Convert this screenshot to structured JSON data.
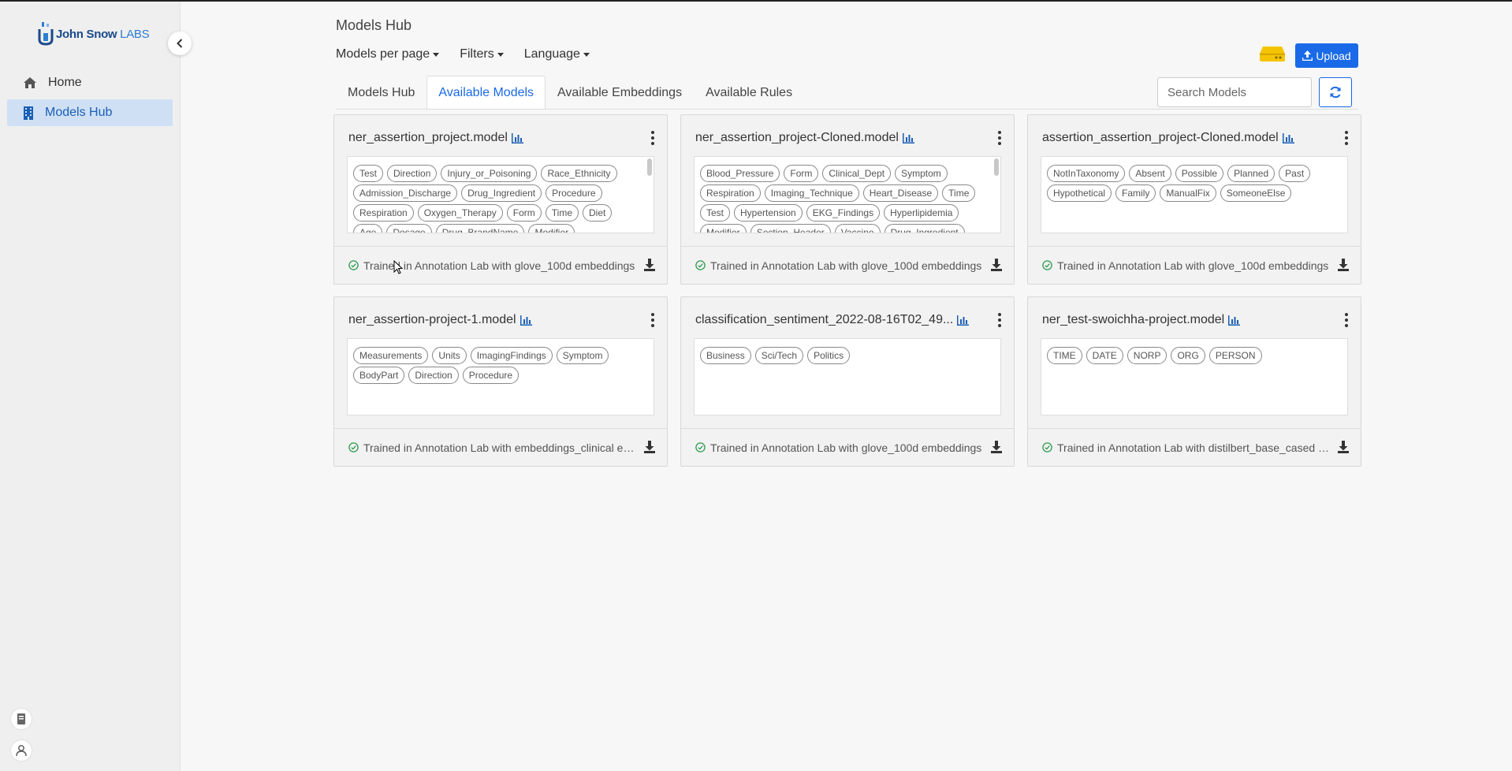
{
  "sidebar": {
    "logo": {
      "brand": "John Snow",
      "labs": "LABS"
    },
    "items": [
      {
        "label": "Home",
        "icon": "home-icon",
        "active": false
      },
      {
        "label": "Models Hub",
        "icon": "building-icon",
        "active": true
      }
    ]
  },
  "header": {
    "title": "Models Hub",
    "menus": [
      "Models per page",
      "Filters",
      "Language"
    ],
    "upload_label": "Upload"
  },
  "tabs": [
    {
      "label": "Models Hub",
      "active": false
    },
    {
      "label": "Available Models",
      "active": true
    },
    {
      "label": "Available Embeddings",
      "active": false
    },
    {
      "label": "Available Rules",
      "active": false
    }
  ],
  "search": {
    "placeholder": "Search Models",
    "value": ""
  },
  "colors": {
    "accent": "#1a6ae8",
    "success": "#2e9b50",
    "storage": "#f5c400"
  },
  "cards": [
    {
      "name": "ner_assertion_project.model",
      "labels": [
        "Test",
        "Direction",
        "Injury_or_Poisoning",
        "Race_Ethnicity",
        "Admission_Discharge",
        "Drug_Ingredient",
        "Procedure",
        "Respiration",
        "Oxygen_Therapy",
        "Form",
        "Time",
        "Diet",
        "Age",
        "Dosage",
        "Drug_BrandName",
        "Modifier"
      ],
      "footer": "Trained in Annotation Lab with glove_100d embeddings",
      "scroll": true
    },
    {
      "name": "ner_assertion_project-Cloned.model",
      "labels": [
        "Blood_Pressure",
        "Form",
        "Clinical_Dept",
        "Symptom",
        "Respiration",
        "Imaging_Technique",
        "Heart_Disease",
        "Time",
        "Test",
        "Hypertension",
        "EKG_Findings",
        "Hyperlipidemia",
        "Modifier",
        "Section_Header",
        "Vaccine",
        "Drug_Ingredient"
      ],
      "footer": "Trained in Annotation Lab with glove_100d embeddings",
      "scroll": true
    },
    {
      "name": "assertion_assertion_project-Cloned.model",
      "labels": [
        "NotInTaxonomy",
        "Absent",
        "Possible",
        "Planned",
        "Past",
        "Hypothetical",
        "Family",
        "ManualFix",
        "SomeoneElse"
      ],
      "footer": "Trained in Annotation Lab with glove_100d embeddings",
      "scroll": false
    },
    {
      "name": "ner_assertion-project-1.model",
      "labels": [
        "Measurements",
        "Units",
        "ImagingFindings",
        "Symptom",
        "BodyPart",
        "Direction",
        "Procedure"
      ],
      "footer": "Trained in Annotation Lab with embeddings_clinical embeddings",
      "scroll": false
    },
    {
      "name": "classification_sentiment_2022-08-16T02_49...",
      "labels": [
        "Business",
        "Sci/Tech",
        "Politics"
      ],
      "footer": "Trained in Annotation Lab with glove_100d embeddings",
      "scroll": false
    },
    {
      "name": "ner_test-swoichha-project.model",
      "labels": [
        "TIME",
        "DATE",
        "NORP",
        "ORG",
        "PERSON"
      ],
      "footer": "Trained in Annotation Lab with distilbert_base_cased embeddings",
      "scroll": false
    }
  ]
}
